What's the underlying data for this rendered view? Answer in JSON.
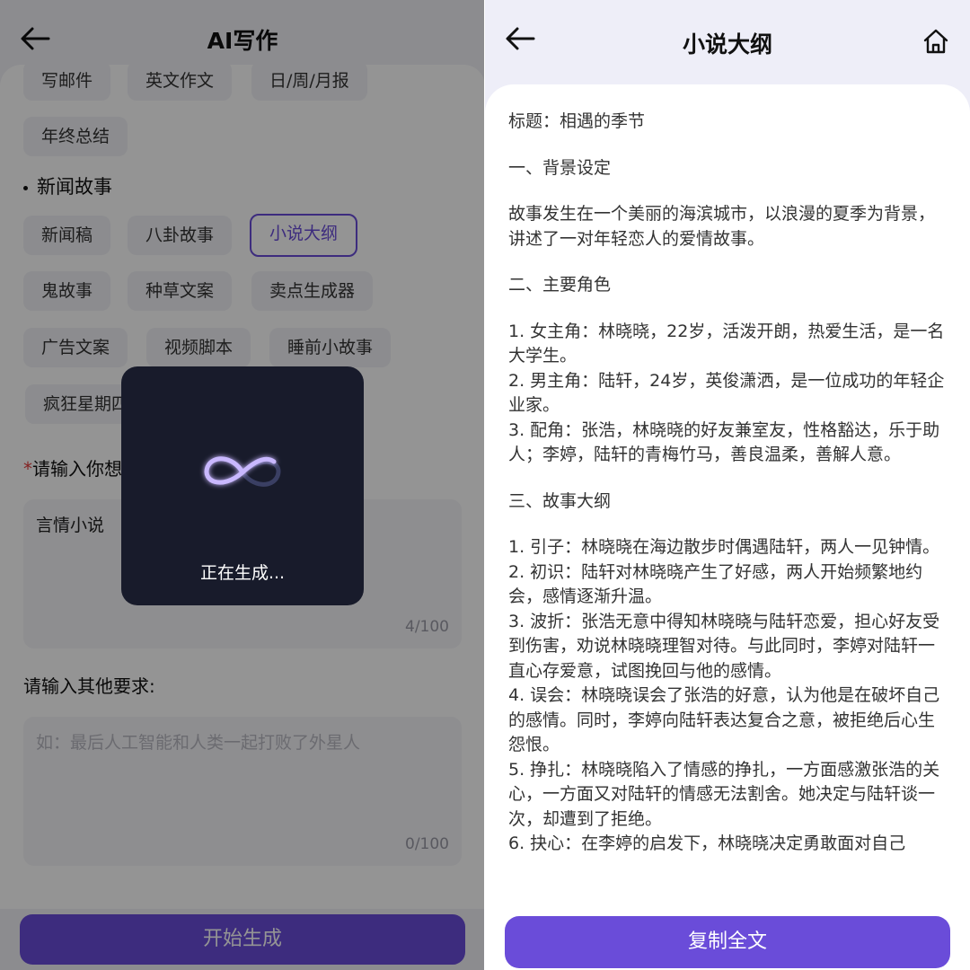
{
  "left": {
    "title": "AI写作",
    "chips_row0": [
      "写邮件",
      "英文作文",
      "日/周/月报"
    ],
    "chip_year": "年终总结",
    "section": "新闻故事",
    "chips": [
      "新闻稿",
      "八卦故事",
      "小说大纲",
      "鬼故事",
      "种草文案",
      "卖点生成器",
      "广告文案",
      "视频脚本",
      "睡前小故事",
      "疯狂星期四"
    ],
    "input_label": "请输入你想",
    "input_value": "言情小说",
    "input_counter": "4/100",
    "other_label": "请输入其他要求:",
    "other_placeholder": "如：最后人工智能和人类一起打败了外星人",
    "other_counter": "0/100",
    "generate_button": "开始生成",
    "loading_text": "正在生成..."
  },
  "right": {
    "title": "小说大纲",
    "copy_button": "复制全文",
    "lines": [
      "标题：相遇的季节",
      "",
      "一、背景设定",
      "",
      "故事发生在一个美丽的海滨城市，以浪漫的夏季为背景，讲述了一对年轻恋人的爱情故事。",
      "",
      "二、主要角色",
      "",
      "1. 女主角：林晓晓，22岁，活泼开朗，热爱生活，是一名大学生。",
      "2. 男主角：陆轩，24岁，英俊潇洒，是一位成功的年轻企业家。",
      "3. 配角：张浩，林晓晓的好友兼室友，性格豁达，乐于助人；李婷，陆轩的青梅竹马，善良温柔，善解人意。",
      "",
      "三、故事大纲",
      "",
      "1. 引子：林晓晓在海边散步时偶遇陆轩，两人一见钟情。",
      "2. 初识：陆轩对林晓晓产生了好感，两人开始频繁地约会，感情逐渐升温。",
      "3. 波折：张浩无意中得知林晓晓与陆轩恋爱，担心好友受到伤害，劝说林晓晓理智对待。与此同时，李婷对陆轩一直心存爱意，试图挽回与他的感情。",
      "4. 误会：林晓晓误会了张浩的好意，认为他是在破坏自己的感情。同时，李婷向陆轩表达复合之意，被拒绝后心生怨恨。",
      "5. 挣扎：林晓晓陷入了情感的挣扎，一方面感激张浩的关心，一方面又对陆轩的情感无法割舍。她决定与陆轩谈一次，却遭到了拒绝。",
      "6. 抉心：在李婷的启发下，林晓晓决定勇敢面对自己"
    ]
  },
  "colors": {
    "accent": "#6a4cd9",
    "loading_bg": "#181b2b"
  },
  "icons": {
    "back": "arrow-left-icon",
    "home": "home-icon",
    "loader": "infinity-icon"
  }
}
